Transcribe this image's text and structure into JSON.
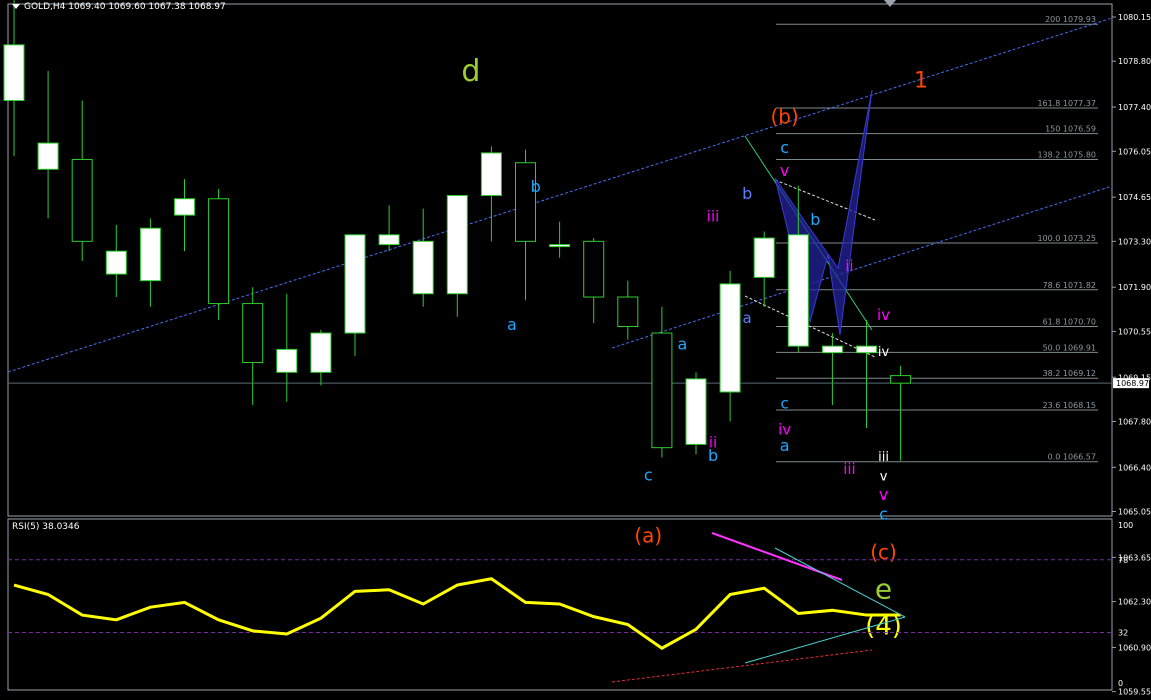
{
  "header": {
    "symbol": "GOLD,H4",
    "open": "1069.40",
    "high": "1069.60",
    "low": "1067.38",
    "close": "1068.97"
  },
  "rsi_header": {
    "label": "RSI(5)",
    "value": "38.0346"
  },
  "colors": {
    "bg": "#000000",
    "candle_up": "#ffffff",
    "wick": "#2ecc2e",
    "grid": "#5a6a78",
    "rsi": "#ffff00",
    "channel": "#4a6cf0",
    "fib": "#7f8c8d",
    "harmonic": "#23239c"
  },
  "chart_data": [
    {
      "type": "candlestick",
      "title": "GOLD,H4",
      "ylim": [
        1059.0,
        1081.0
      ],
      "y_ticks": [
        "1080.15",
        "1078.80",
        "1077.40",
        "1076.05",
        "1074.65",
        "1073.30",
        "1071.90",
        "1070.55",
        "1069.15",
        "1067.80",
        "1066.40",
        "1065.05",
        "1063.65",
        "1062.30",
        "1060.90",
        "1059.55"
      ],
      "current_price": "1068.97",
      "candles": [
        {
          "o": 1077.6,
          "h": 1081.0,
          "l": 1075.9,
          "c": 1079.3
        },
        {
          "o": 1075.5,
          "h": 1078.5,
          "l": 1074.0,
          "c": 1076.3
        },
        {
          "o": 1075.8,
          "h": 1077.6,
          "l": 1072.7,
          "c": 1073.3
        },
        {
          "o": 1072.3,
          "h": 1073.8,
          "l": 1071.6,
          "c": 1073.0
        },
        {
          "o": 1072.1,
          "h": 1074.0,
          "l": 1071.3,
          "c": 1073.7
        },
        {
          "o": 1074.1,
          "h": 1075.2,
          "l": 1073.0,
          "c": 1074.6
        },
        {
          "o": 1074.6,
          "h": 1074.9,
          "l": 1070.9,
          "c": 1071.4
        },
        {
          "o": 1071.4,
          "h": 1071.9,
          "l": 1068.3,
          "c": 1069.6
        },
        {
          "o": 1069.3,
          "h": 1071.7,
          "l": 1068.4,
          "c": 1070.0
        },
        {
          "o": 1069.3,
          "h": 1070.6,
          "l": 1068.9,
          "c": 1070.5
        },
        {
          "o": 1070.5,
          "h": 1073.5,
          "l": 1069.8,
          "c": 1073.5
        },
        {
          "o": 1073.2,
          "h": 1074.4,
          "l": 1073.0,
          "c": 1073.5
        },
        {
          "o": 1071.7,
          "h": 1074.3,
          "l": 1071.3,
          "c": 1073.3
        },
        {
          "o": 1071.7,
          "h": 1074.6,
          "l": 1071.0,
          "c": 1074.7
        },
        {
          "o": 1074.7,
          "h": 1076.2,
          "l": 1073.3,
          "c": 1076.0
        },
        {
          "o": 1075.7,
          "h": 1076.1,
          "l": 1071.5,
          "c": 1073.3
        },
        {
          "o": 1073.2,
          "h": 1073.9,
          "l": 1072.8,
          "c": 1073.2
        },
        {
          "o": 1073.3,
          "h": 1073.4,
          "l": 1070.8,
          "c": 1071.6
        },
        {
          "o": 1071.6,
          "h": 1072.1,
          "l": 1070.3,
          "c": 1070.7
        },
        {
          "o": 1070.5,
          "h": 1071.3,
          "l": 1066.7,
          "c": 1067.0
        },
        {
          "o": 1067.1,
          "h": 1069.3,
          "l": 1066.8,
          "c": 1069.1
        },
        {
          "o": 1068.7,
          "h": 1072.4,
          "l": 1067.8,
          "c": 1072.0
        },
        {
          "o": 1072.2,
          "h": 1073.6,
          "l": 1071.3,
          "c": 1073.4
        },
        {
          "o": 1070.1,
          "h": 1075.0,
          "l": 1069.9,
          "c": 1073.5
        },
        {
          "o": 1069.9,
          "h": 1070.5,
          "l": 1068.3,
          "c": 1070.1
        },
        {
          "o": 1069.9,
          "h": 1070.9,
          "l": 1067.6,
          "c": 1070.1
        },
        {
          "o": 1069.2,
          "h": 1069.5,
          "l": 1066.6,
          "c": 1068.97
        }
      ],
      "fib_levels": [
        {
          "pct": "200",
          "price": "1079.93"
        },
        {
          "pct": "161.8",
          "price": "1077.37"
        },
        {
          "pct": "150",
          "price": "1076.59"
        },
        {
          "pct": "138.2",
          "price": "1075.80"
        },
        {
          "pct": "100.0",
          "price": "1073.25"
        },
        {
          "pct": "78.6",
          "price": "1071.82"
        },
        {
          "pct": "61.8",
          "price": "1070.70"
        },
        {
          "pct": "50.0",
          "price": "1069.91"
        },
        {
          "pct": "38.2",
          "price": "1069.12"
        },
        {
          "pct": "23.6",
          "price": "1068.15"
        },
        {
          "pct": "0.0",
          "price": "1066.57"
        }
      ],
      "wave_labels": [
        {
          "t": "d",
          "color": "#9acd32",
          "size": 30,
          "i": 13.4,
          "p": 1078.2
        },
        {
          "t": "(b)",
          "color": "#ff4500",
          "size": 20,
          "i": 22.6,
          "p": 1076.9
        },
        {
          "t": "1",
          "color": "#ff4500",
          "size": 22,
          "i": 26.6,
          "p": 1078.0
        },
        {
          "t": "b",
          "color": "#1ea7ff",
          "size": 16,
          "i": 15.3,
          "p": 1074.8
        },
        {
          "t": "a",
          "color": "#1ea7ff",
          "size": 16,
          "i": 14.6,
          "p": 1070.6
        },
        {
          "t": "iii",
          "color": "#ff00ff",
          "size": 15,
          "i": 20.5,
          "p": 1073.9
        },
        {
          "t": "b",
          "color": "#5a7cff",
          "size": 16,
          "i": 21.5,
          "p": 1074.6
        },
        {
          "t": "a",
          "color": "#5a7cff",
          "size": 15,
          "i": 21.5,
          "p": 1070.8
        },
        {
          "t": "a",
          "color": "#1ea7ff",
          "size": 16,
          "i": 19.6,
          "p": 1070.0
        },
        {
          "t": "ii",
          "color": "#ff00ff",
          "size": 15,
          "i": 20.5,
          "p": 1067.0
        },
        {
          "t": "b",
          "color": "#1ea7ff",
          "size": 16,
          "i": 20.5,
          "p": 1066.6
        },
        {
          "t": "c",
          "color": "#1ea7ff",
          "size": 16,
          "i": 18.6,
          "p": 1066.0
        },
        {
          "t": "(a)",
          "color": "#ff4500",
          "size": 20,
          "i": 18.6,
          "p": 1064.1
        },
        {
          "t": "c",
          "color": "#1ea7ff",
          "size": 16,
          "i": 22.6,
          "p": 1076.0
        },
        {
          "t": "v",
          "color": "#ff00ff",
          "size": 16,
          "i": 22.6,
          "p": 1075.3
        },
        {
          "t": "b",
          "color": "#1ea7ff",
          "size": 16,
          "i": 23.5,
          "p": 1073.8
        },
        {
          "t": "ii",
          "color": "#ff00ff",
          "size": 15,
          "i": 24.5,
          "p": 1072.4
        },
        {
          "t": "iv",
          "color": "#ff00ff",
          "size": 15,
          "i": 25.5,
          "p": 1070.9
        },
        {
          "t": "c",
          "color": "#1ea7ff",
          "size": 15,
          "i": 22.6,
          "p": 1068.2
        },
        {
          "t": "iv",
          "color": "#ff00ff",
          "size": 15,
          "i": 22.6,
          "p": 1067.4
        },
        {
          "t": "a",
          "color": "#1ea7ff",
          "size": 16,
          "i": 22.6,
          "p": 1066.9
        },
        {
          "t": "iii",
          "color": "#ff00ff",
          "size": 15,
          "i": 24.5,
          "p": 1066.2
        },
        {
          "t": "iv",
          "color": "#ffffff",
          "size": 13,
          "i": 25.5,
          "p": 1069.8
        },
        {
          "t": "iii",
          "color": "#ffffff",
          "size": 13,
          "i": 25.5,
          "p": 1066.6
        },
        {
          "t": "v",
          "color": "#ffffff",
          "size": 13,
          "i": 25.5,
          "p": 1066.0
        },
        {
          "t": "v",
          "color": "#ff00ff",
          "size": 16,
          "i": 25.5,
          "p": 1065.4
        },
        {
          "t": "c",
          "color": "#1ea7ff",
          "size": 16,
          "i": 25.5,
          "p": 1064.8
        },
        {
          "t": "(c)",
          "color": "#ff4500",
          "size": 20,
          "i": 25.5,
          "p": 1063.6
        },
        {
          "t": "e",
          "color": "#9acd32",
          "size": 28,
          "i": 25.5,
          "p": 1062.4
        },
        {
          "t": "(4)",
          "color": "#ffff00",
          "size": 26,
          "i": 25.5,
          "p": 1061.3
        }
      ]
    },
    {
      "type": "line",
      "title": "RSI(5) 38.0346",
      "ylim": [
        0,
        100
      ],
      "y_ticks": [
        "100",
        "78",
        "32",
        "0"
      ],
      "values": [
        62,
        56,
        43,
        40,
        48,
        51,
        40,
        33,
        31,
        41,
        58,
        59,
        50,
        62,
        66,
        51,
        50,
        42,
        37,
        22,
        34,
        56,
        60,
        44,
        46,
        43,
        43
      ]
    }
  ]
}
